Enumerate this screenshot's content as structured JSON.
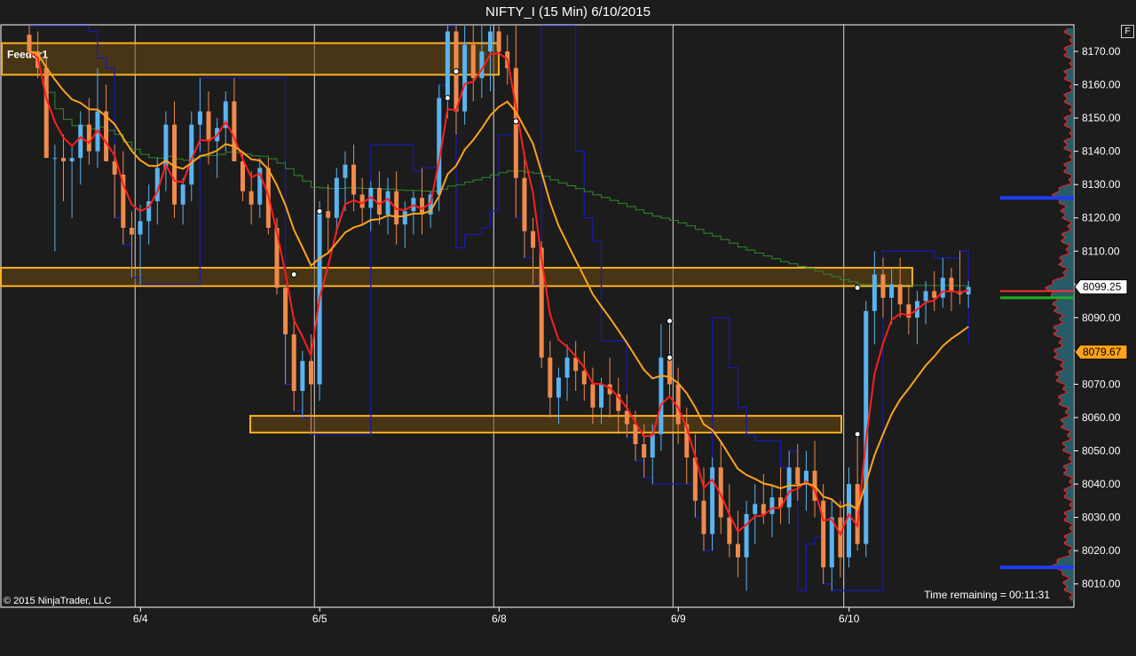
{
  "window": {
    "title": "NIFTY_I (15 Min)  6/10/2015"
  },
  "toolbar": {
    "f_button_label": "F"
  },
  "chart": {
    "copyright": "© 2015 NinjaTrader, LLC",
    "time_remaining": "Time remaining = 00:11:31",
    "zones": [
      {
        "label": "Feeder1",
        "y_top": 8172.5,
        "y_bottom": 8163.0
      },
      {
        "label": "",
        "y_top": 8105.0,
        "y_bottom": 8099.5
      },
      {
        "label": "",
        "y_top": 8060.5,
        "y_bottom": 8055.5
      }
    ],
    "price_markers": [
      {
        "label": "8099.25",
        "value": 8099.25,
        "style": "last"
      },
      {
        "label": "8079.67",
        "value": 8079.67,
        "style": "indicator"
      }
    ],
    "colors": {
      "background": "#1c1c1c",
      "plot_bg": "#1c1c1c",
      "up_candle": "#5ab4f0",
      "down_candle": "#f08a4b",
      "red_ma": "#ff1e1e",
      "orange_ma": "#ffa31a",
      "navy_line": "#1a1aa8",
      "green_line": "#2c8a2c",
      "zone_stroke": "#ffb020",
      "zone_fill": "#6b4a10"
    }
  },
  "chart_data": {
    "type": "candlestick",
    "title": "NIFTY_I (15 Min)  6/10/2015",
    "x_ticks": [
      "6/4",
      "6/5",
      "6/8",
      "6/9",
      "6/10"
    ],
    "y_ticks": [
      "8170.00",
      "8160.00",
      "8150.00",
      "8140.00",
      "8130.00",
      "8120.00",
      "8110.00",
      "8100.00",
      "8090.00",
      "8080.00",
      "8070.00",
      "8060.00",
      "8050.00",
      "8040.00",
      "8030.00",
      "8020.00",
      "8010.00"
    ],
    "ylim": [
      8003,
      8178
    ],
    "last_price": 8099.25,
    "indicator_value": 8079.67,
    "candles": [
      [
        8175,
        8178,
        8168,
        8170
      ],
      [
        8170,
        8176,
        8162,
        8165
      ],
      [
        8165,
        8168,
        8145,
        8138
      ],
      [
        8138,
        8142,
        8110,
        8138
      ],
      [
        8138,
        8145,
        8125,
        8137
      ],
      [
        8137,
        8142,
        8120,
        8138
      ],
      [
        8138,
        8152,
        8130,
        8148
      ],
      [
        8148,
        8156,
        8136,
        8140
      ],
      [
        8140,
        8165,
        8135,
        8152
      ],
      [
        8152,
        8160,
        8138,
        8137
      ],
      [
        8137,
        8142,
        8120,
        8133
      ],
      [
        8133,
        8140,
        8112,
        8117
      ],
      [
        8117,
        8122,
        8102,
        8115
      ],
      [
        8115,
        8124,
        8100,
        8119
      ],
      [
        8119,
        8130,
        8112,
        8125
      ],
      [
        8125,
        8138,
        8118,
        8135
      ],
      [
        8135,
        8152,
        8128,
        8148
      ],
      [
        8148,
        8155,
        8120,
        8124
      ],
      [
        8124,
        8132,
        8118,
        8130
      ],
      [
        8130,
        8152,
        8125,
        8148
      ],
      [
        8148,
        8162,
        8140,
        8152
      ],
      [
        8152,
        8158,
        8136,
        8143
      ],
      [
        8143,
        8150,
        8132,
        8147
      ],
      [
        8147,
        8158,
        8140,
        8155
      ],
      [
        8155,
        8162,
        8142,
        8137
      ],
      [
        8137,
        8140,
        8125,
        8128
      ],
      [
        8128,
        8134,
        8118,
        8124
      ],
      [
        8124,
        8138,
        8120,
        8135
      ],
      [
        8135,
        8138,
        8115,
        8117
      ],
      [
        8117,
        8120,
        8097,
        8099
      ],
      [
        8099,
        8100,
        8070,
        8085
      ],
      [
        8085,
        8090,
        8062,
        8068
      ],
      [
        8068,
        8080,
        8060,
        8077
      ],
      [
        8077,
        8085,
        8055,
        8070
      ],
      [
        8070,
        8125,
        8065,
        8122
      ],
      [
        8122,
        8130,
        8110,
        8120
      ],
      [
        8120,
        8135,
        8115,
        8132
      ],
      [
        8132,
        8140,
        8122,
        8136
      ],
      [
        8136,
        8142,
        8122,
        8127
      ],
      [
        8127,
        8132,
        8118,
        8123
      ],
      [
        8123,
        8131,
        8116,
        8129
      ],
      [
        8129,
        8134,
        8118,
        8121
      ],
      [
        8121,
        8132,
        8115,
        8128
      ],
      [
        8128,
        8134,
        8112,
        8118
      ],
      [
        8118,
        8125,
        8111,
        8122
      ],
      [
        8122,
        8128,
        8115,
        8126
      ],
      [
        8126,
        8135,
        8115,
        8121
      ],
      [
        8121,
        8128,
        8117,
        8127
      ],
      [
        8127,
        8160,
        8122,
        8156
      ],
      [
        8156,
        8178,
        8150,
        8176
      ],
      [
        8176,
        8178,
        8145,
        8152
      ],
      [
        8152,
        8178,
        8148,
        8172
      ],
      [
        8172,
        8178,
        8155,
        8162
      ],
      [
        8162,
        8178,
        8156,
        8170
      ],
      [
        8170,
        8178,
        8158,
        8176
      ],
      [
        8176,
        8178,
        8165,
        8170
      ],
      [
        8170,
        8175,
        8160,
        8165
      ],
      [
        8165,
        8178,
        8120,
        8132
      ],
      [
        8132,
        8140,
        8108,
        8116
      ],
      [
        8116,
        8120,
        8100,
        8111
      ],
      [
        8111,
        8113,
        8075,
        8078
      ],
      [
        8078,
        8083,
        8060,
        8066
      ],
      [
        8066,
        8075,
        8058,
        8072
      ],
      [
        8072,
        8082,
        8065,
        8078
      ],
      [
        8078,
        8083,
        8068,
        8074
      ],
      [
        8074,
        8080,
        8065,
        8070
      ],
      [
        8070,
        8075,
        8058,
        8063
      ],
      [
        8063,
        8072,
        8058,
        8070
      ],
      [
        8070,
        8078,
        8060,
        8067
      ],
      [
        8067,
        8072,
        8055,
        8062
      ],
      [
        8062,
        8067,
        8054,
        8058
      ],
      [
        8058,
        8062,
        8047,
        8052
      ],
      [
        8052,
        8058,
        8042,
        8048
      ],
      [
        8048,
        8058,
        8040,
        8055
      ],
      [
        8055,
        8088,
        8050,
        8078
      ],
      [
        8078,
        8090,
        8066,
        8070
      ],
      [
        8070,
        8075,
        8052,
        8058
      ],
      [
        8058,
        8063,
        8040,
        8048
      ],
      [
        8048,
        8055,
        8030,
        8035
      ],
      [
        8035,
        8045,
        8020,
        8025
      ],
      [
        8025,
        8048,
        8020,
        8045
      ],
      [
        8045,
        8053,
        8025,
        8030
      ],
      [
        8030,
        8040,
        8018,
        8022
      ],
      [
        8022,
        8032,
        8012,
        8018
      ],
      [
        8018,
        8035,
        8008,
        8031
      ],
      [
        8031,
        8040,
        8022,
        8034
      ],
      [
        8034,
        8043,
        8028,
        8031
      ],
      [
        8031,
        8040,
        8024,
        8036
      ],
      [
        8036,
        8045,
        8028,
        8033
      ],
      [
        8033,
        8050,
        8028,
        8045
      ],
      [
        8045,
        8052,
        8035,
        8040
      ],
      [
        8040,
        8050,
        8032,
        8044
      ],
      [
        8044,
        8053,
        8030,
        8035
      ],
      [
        8035,
        8040,
        8010,
        8015
      ],
      [
        8015,
        8035,
        8008,
        8030
      ],
      [
        8030,
        8035,
        8012,
        8018
      ],
      [
        8018,
        8045,
        8015,
        8040
      ],
      [
        8040,
        8055,
        8020,
        8022
      ],
      [
        8022,
        8095,
        8018,
        8092
      ],
      [
        8092,
        8110,
        8082,
        8103
      ],
      [
        8103,
        8108,
        8090,
        8096
      ],
      [
        8096,
        8105,
        8088,
        8100
      ],
      [
        8100,
        8108,
        8090,
        8094
      ],
      [
        8094,
        8100,
        8085,
        8090
      ],
      [
        8090,
        8098,
        8082,
        8095
      ],
      [
        8095,
        8101,
        8088,
        8098
      ],
      [
        8098,
        8104,
        8092,
        8096
      ],
      [
        8096,
        8108,
        8093,
        8102
      ],
      [
        8102,
        8105,
        8092,
        8098
      ],
      [
        8098,
        8110,
        8094,
        8097
      ],
      [
        8097,
        8101,
        8093,
        8099.25
      ]
    ],
    "volume_profile_peaks": [
      8126,
      8098,
      8015
    ]
  }
}
